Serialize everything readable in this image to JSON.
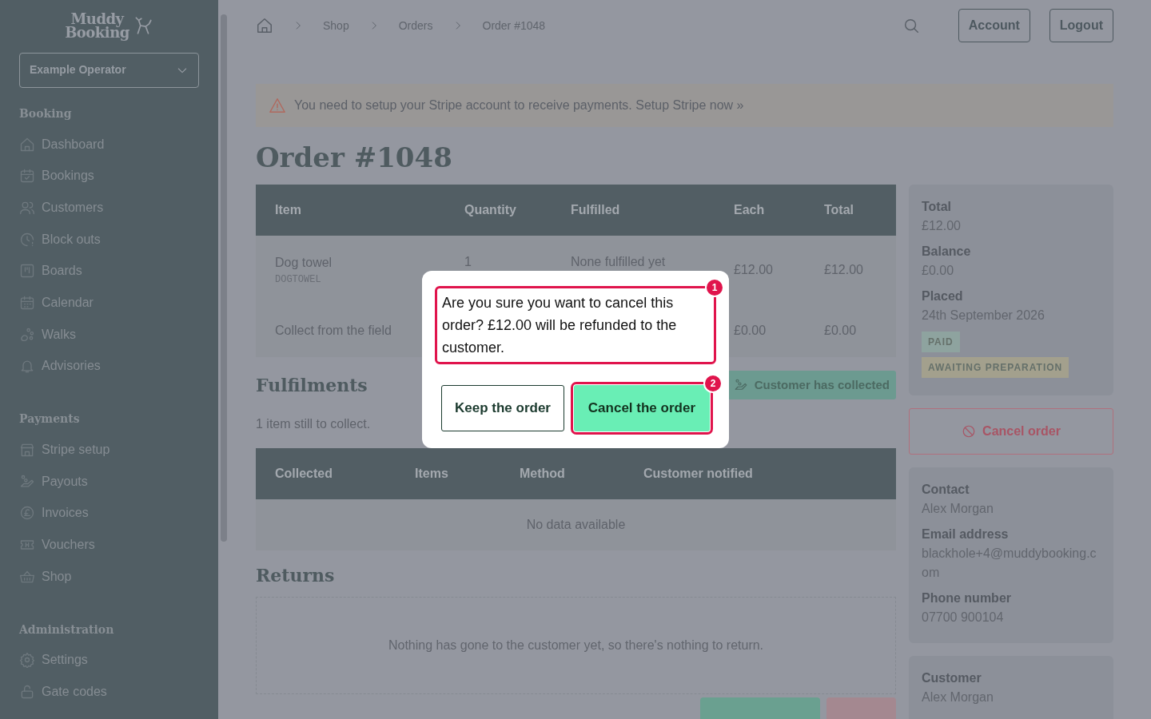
{
  "sidebar": {
    "logo_lines": [
      "Muddy",
      "Booking"
    ],
    "operator": "Example Operator",
    "sections": [
      {
        "title": "Booking",
        "items": [
          {
            "label": "Dashboard"
          },
          {
            "label": "Bookings"
          },
          {
            "label": "Customers"
          },
          {
            "label": "Block outs"
          },
          {
            "label": "Boards"
          },
          {
            "label": "Calendar"
          },
          {
            "label": "Walks"
          },
          {
            "label": "Advisories"
          }
        ]
      },
      {
        "title": "Payments",
        "items": [
          {
            "label": "Stripe setup"
          },
          {
            "label": "Payouts"
          },
          {
            "label": "Invoices"
          },
          {
            "label": "Vouchers"
          },
          {
            "label": "Shop"
          }
        ]
      },
      {
        "title": "Administration",
        "items": [
          {
            "label": "Settings"
          },
          {
            "label": "Gate codes"
          }
        ]
      }
    ]
  },
  "header": {
    "breadcrumb": [
      "Shop",
      "Orders",
      "Order #1048"
    ],
    "buttons": [
      "Account",
      "Logout"
    ]
  },
  "alert": {
    "text": "You need to setup your Stripe account to receive payments.",
    "link": "Setup Stripe now »"
  },
  "title": "Order #1048",
  "items_table": {
    "columns": [
      "Item",
      "Quantity",
      "Fulfilled",
      "Each",
      "Total"
    ],
    "rows": [
      {
        "item": "Dog towel",
        "sku": "DOGTOWEL",
        "quantity": "1",
        "fulfilled": "None fulfilled yet",
        "each": "£12.00",
        "total": "£12.00"
      },
      {
        "item": "Collect from the field",
        "each": "£0.00",
        "total": "£0.00"
      }
    ]
  },
  "fulfilments": {
    "title": "Fulfilments",
    "action": "Customer has collected",
    "note": "1 item still to collect.",
    "columns": [
      "Collected",
      "Items",
      "Method",
      "Customer notified"
    ],
    "empty": "No data available"
  },
  "returns": {
    "title": "Returns",
    "empty": "Nothing has gone to the customer yet, so there's nothing to return."
  },
  "summary": {
    "fields": [
      {
        "label": "Total",
        "value": "£12.00"
      },
      {
        "label": "Balance",
        "value": "£0.00"
      },
      {
        "label": "Placed",
        "value": "24th September 2026"
      }
    ],
    "badges": [
      {
        "text": "PAID",
        "color": "#8ea39f"
      },
      {
        "text": "AWAITING PREPARATION",
        "color": "#a3a08d"
      }
    ]
  },
  "cancel_button": "Cancel order",
  "contact": {
    "fields": [
      {
        "label": "Contact",
        "value": "Alex Morgan"
      },
      {
        "label": "Email address",
        "value": "blackhole+4@muddybooking.com"
      },
      {
        "label": "Phone number",
        "value": "07700 900104"
      }
    ]
  },
  "customer": {
    "fields": [
      {
        "label": "Customer",
        "value": "Alex Morgan"
      }
    ]
  },
  "modal": {
    "message": "Are you sure you want to cancel this order? £12.00 will be refunded to the customer.",
    "message_marker": "1",
    "buttons": [
      {
        "label": "Keep the order",
        "kind": "secondary"
      },
      {
        "label": "Cancel the order",
        "kind": "primary",
        "marker": "2"
      }
    ]
  }
}
